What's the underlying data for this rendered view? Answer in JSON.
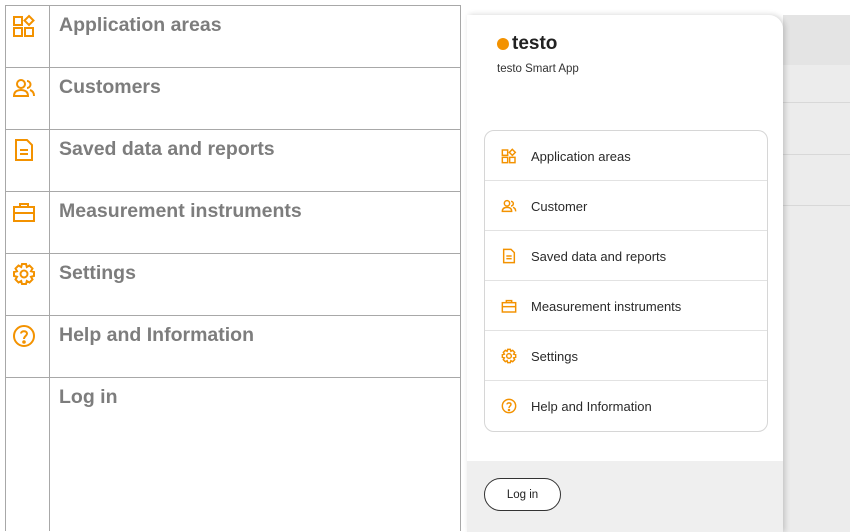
{
  "colors": {
    "accent": "#f39200",
    "doc_label": "#7d7d7d",
    "border": "#a8a8a8",
    "footer_bg": "#efefef"
  },
  "doc_table": {
    "rows": [
      {
        "label": "Application areas",
        "icon": "grid-icon"
      },
      {
        "label": "Customers",
        "icon": "customers-icon"
      },
      {
        "label": "Saved data and reports",
        "icon": "document-icon"
      },
      {
        "label": "Measurement instruments",
        "icon": "toolbox-icon"
      },
      {
        "label": "Settings",
        "icon": "settings-gear-icon"
      },
      {
        "label": "Help and Information",
        "icon": "help-icon"
      },
      {
        "label": "Log in",
        "icon": ""
      }
    ]
  },
  "app": {
    "brand": "testo",
    "subtitle": "testo Smart App",
    "menu": [
      {
        "label": "Application areas",
        "icon": "grid-icon"
      },
      {
        "label": "Customer",
        "icon": "customers-icon"
      },
      {
        "label": "Saved data and reports",
        "icon": "document-icon"
      },
      {
        "label": "Measurement instruments",
        "icon": "toolbox-icon"
      },
      {
        "label": "Settings",
        "icon": "settings-gear-icon"
      },
      {
        "label": "Help and Information",
        "icon": "help-icon"
      }
    ],
    "login_button": "Log in"
  }
}
